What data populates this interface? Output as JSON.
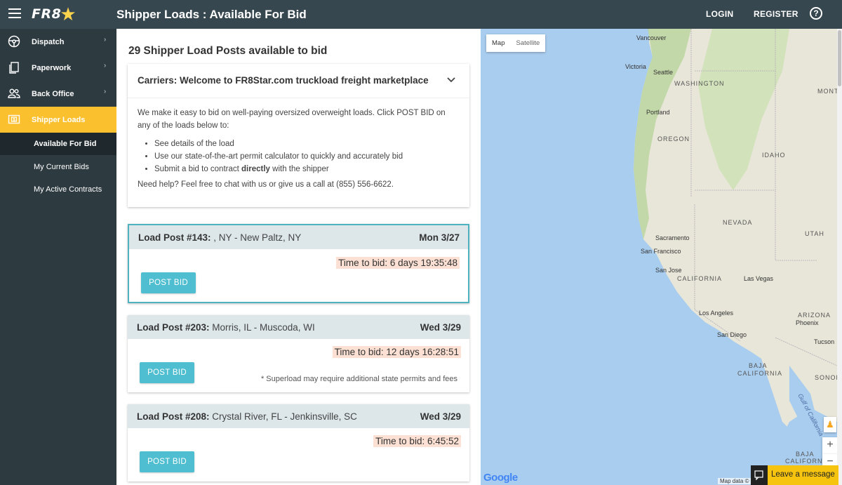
{
  "header": {
    "logo_text": "FR8",
    "logo_star": "★",
    "title": "Shipper Loads : Available For Bid",
    "login": "LOGIN",
    "register": "REGISTER",
    "help_glyph": "?"
  },
  "sidebar": {
    "items": [
      {
        "label": "Dispatch",
        "icon": "steering-wheel-icon"
      },
      {
        "label": "Paperwork",
        "icon": "documents-icon"
      },
      {
        "label": "Back Office",
        "icon": "people-icon"
      },
      {
        "label": "Shipper Loads",
        "icon": "dollar-icon"
      }
    ],
    "sub_items": [
      {
        "label": "Available For Bid"
      },
      {
        "label": "My Current Bids"
      },
      {
        "label": "My Active Contracts"
      }
    ],
    "chevron": "›"
  },
  "main": {
    "count_title": "29 Shipper Load Posts available to bid",
    "welcome": {
      "heading": "Carriers: Welcome to FR8Star.com truckload freight marketplace",
      "intro": "We make it easy to bid on well-paying oversized overweight loads. Click POST BID on any of the loads below to:",
      "bullets": {
        "b1": "See details of the load",
        "b2": "Use our state-of-the-art permit calculator to quickly and accurately bid",
        "b3_pre": "Submit a bid to contract ",
        "b3_strong": "directly",
        "b3_post": " with the shipper"
      },
      "help": "Need help? Feel free to chat with us or give us a call at (855) 556-6622."
    },
    "loads": [
      {
        "label": "Load Post #143:",
        "route": " , NY - New Paltz, NY",
        "date": "Mon 3/27",
        "timer": "Time to bid: 6 days 19:35:48",
        "button": "POST BID"
      },
      {
        "label": "Load Post #203:",
        "route": " Morris, IL - Muscoda, WI",
        "date": "Wed 3/29",
        "timer": "Time to bid: 12 days 16:28:51",
        "button": "POST BID",
        "note": "* Superload may require additional state permits and fees"
      },
      {
        "label": "Load Post #208:",
        "route": " Crystal River, FL - Jenkinsville, SC",
        "date": "Wed 3/29",
        "timer": "Time to bid: 6:45:52",
        "button": "POST BID"
      }
    ]
  },
  "map": {
    "btn_map": "Map",
    "btn_satellite": "Satellite",
    "cities": {
      "vancouver": "Vancouver",
      "victoria": "Victoria",
      "seattle": "Seattle",
      "portland": "Portland",
      "sacramento": "Sacramento",
      "san_francisco": "San Francisco",
      "san_jose": "San Jose",
      "las_vegas": "Las Vegas",
      "los_angeles": "Los Angeles",
      "phoenix": "Phoenix",
      "san_diego": "San Diego",
      "tucson": "Tucson"
    },
    "states": {
      "washington": "WASHINGTON",
      "mont": "MONT",
      "oregon": "OREGON",
      "idaho": "IDAHO",
      "nevada": "NEVADA",
      "utah": "UTAH",
      "california": "CALIFORNIA",
      "arizona": "ARIZONA",
      "baja": "BAJA",
      "baja_california": "CALIFORNIA",
      "sonora": "SONORA",
      "baja_sur": "BAJA",
      "baja_sur_california": "CALIFORNIA",
      "gulf": "Gulf of California"
    },
    "google": "Google",
    "mapdata": "Map data ©",
    "zoom_in": "+",
    "zoom_out": "−",
    "pegman": "♟"
  },
  "chat": {
    "label": "Leave a message"
  }
}
